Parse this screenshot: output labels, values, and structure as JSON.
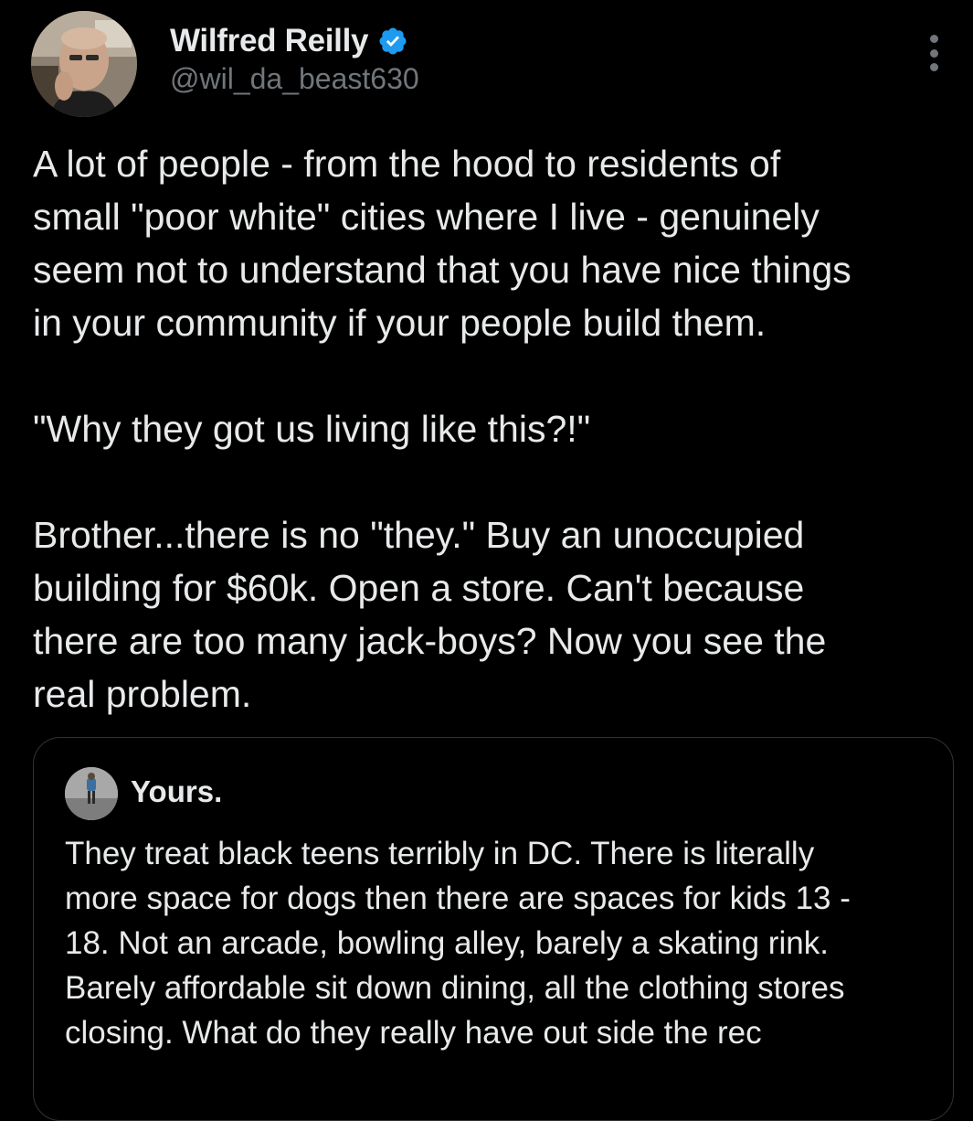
{
  "tweet": {
    "author": {
      "display_name": "Wilfred Reilly",
      "handle": "@wil_da_beast630",
      "verified_icon": "verified-badge-icon",
      "avatar_icon": "user-avatar-photo"
    },
    "more_icon": "more-options-icon",
    "body": [
      "A lot of people - from the hood to residents of",
      "small \"poor white\" cities where I live - genuinely",
      "seem not to understand that you have nice things",
      "in your community if your people build them.",
      "",
      "\"Why they got us living like this?!\"",
      "",
      "Brother...there is no \"they.\" Buy an unoccupied",
      "building for $60k. Open a store. Can't because",
      "there are too many jack-boys? Now you see the",
      "real problem."
    ]
  },
  "quoted": {
    "author": {
      "display_name": "Yours.",
      "avatar_icon": "quoted-user-avatar-photo"
    },
    "body": [
      "They treat black teens terribly in DC. There is literally",
      "more space for dogs then there are spaces for kids 13 -",
      "18. Not an arcade, bowling alley, barely a skating rink.",
      "Barely affordable sit down dining, all the clothing stores",
      "closing. What do they really have out side the rec"
    ]
  },
  "colors": {
    "background": "#000000",
    "text_primary": "#e7e9ea",
    "text_secondary": "#71767b",
    "verified_blue": "#1d9bf0",
    "border": "#2f3336"
  }
}
